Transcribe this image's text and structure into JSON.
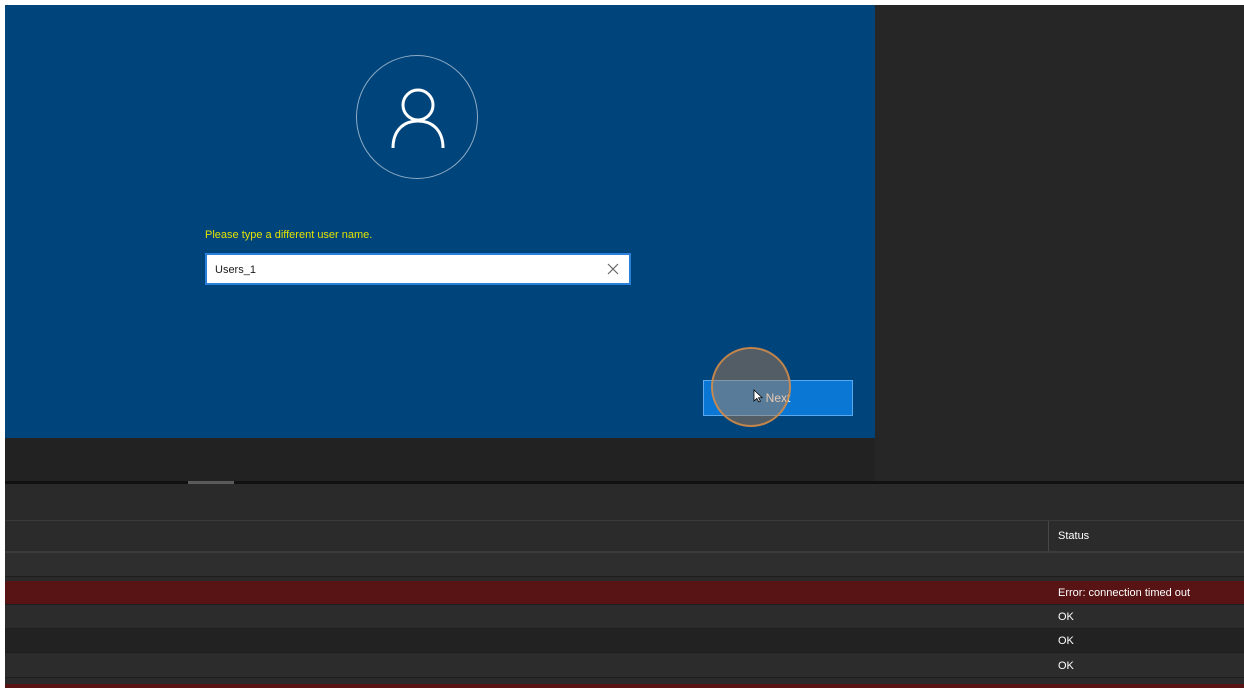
{
  "login": {
    "prompt": "Please type a different user name.",
    "username_value": "Users_1",
    "next_label": "Next"
  },
  "icons": {
    "avatar": "user-silhouette-icon",
    "clear": "close-icon",
    "cursor": "mouse-pointer-icon"
  },
  "log_table": {
    "columns": [
      "Status"
    ],
    "rows": [
      {
        "status": "",
        "kind": "blank"
      },
      {
        "status": "Error: connection timed out",
        "kind": "error"
      },
      {
        "status": "OK",
        "kind": "ok"
      },
      {
        "status": "OK",
        "kind": "ok"
      },
      {
        "status": "OK",
        "kind": "ok"
      }
    ]
  },
  "colors": {
    "login_background": "#00447c",
    "prompt_text": "#e3e300",
    "next_button": "#0a77d4",
    "error_row": "#581414",
    "click_marker": "#d68c46"
  }
}
